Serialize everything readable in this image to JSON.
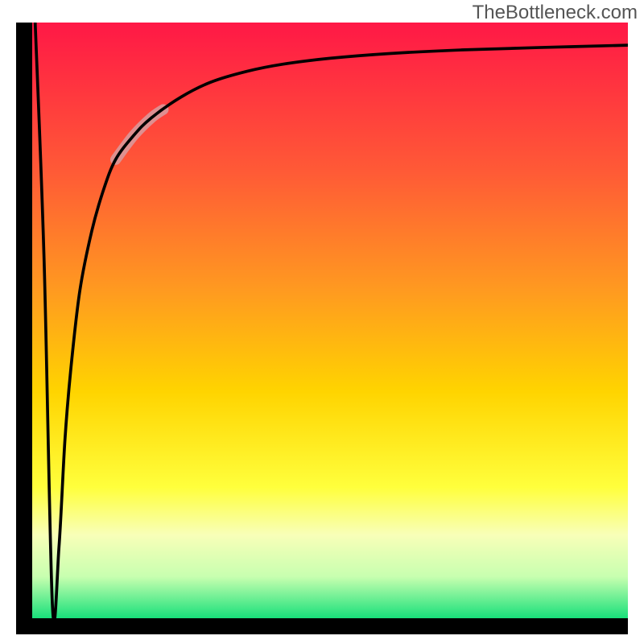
{
  "watermark": "TheBottleneck.com",
  "gradient": {
    "stops": [
      {
        "offset": 0,
        "color": "#ff1846"
      },
      {
        "offset": 0.25,
        "color": "#ff5a36"
      },
      {
        "offset": 0.45,
        "color": "#ff9a20"
      },
      {
        "offset": 0.62,
        "color": "#ffd400"
      },
      {
        "offset": 0.78,
        "color": "#ffff3c"
      },
      {
        "offset": 0.86,
        "color": "#f8ffb8"
      },
      {
        "offset": 0.93,
        "color": "#c8ffb0"
      },
      {
        "offset": 1.0,
        "color": "#18e07a"
      }
    ]
  },
  "chart_data": {
    "type": "line",
    "title": "",
    "xlabel": "",
    "ylabel": "",
    "xlim": [
      0,
      100
    ],
    "ylim": [
      0,
      100
    ],
    "grid": false,
    "legend": false,
    "series": [
      {
        "name": "curve",
        "x": [
          0.5,
          2.0,
          3.4,
          4.5,
          5.5,
          6.5,
          8,
          10,
          12,
          14,
          17,
          20,
          25,
          30,
          36,
          42,
          50,
          60,
          72,
          85,
          100
        ],
        "y": [
          100,
          60,
          2,
          12,
          30,
          42,
          55,
          65,
          72,
          77,
          81,
          84,
          87.5,
          90,
          91.8,
          93,
          94,
          94.8,
          95.4,
          95.8,
          96.2
        ]
      }
    ],
    "highlight_segment": {
      "description": "pale thick stroke over part of curve",
      "series": "curve",
      "x_range": [
        14,
        22
      ]
    }
  }
}
